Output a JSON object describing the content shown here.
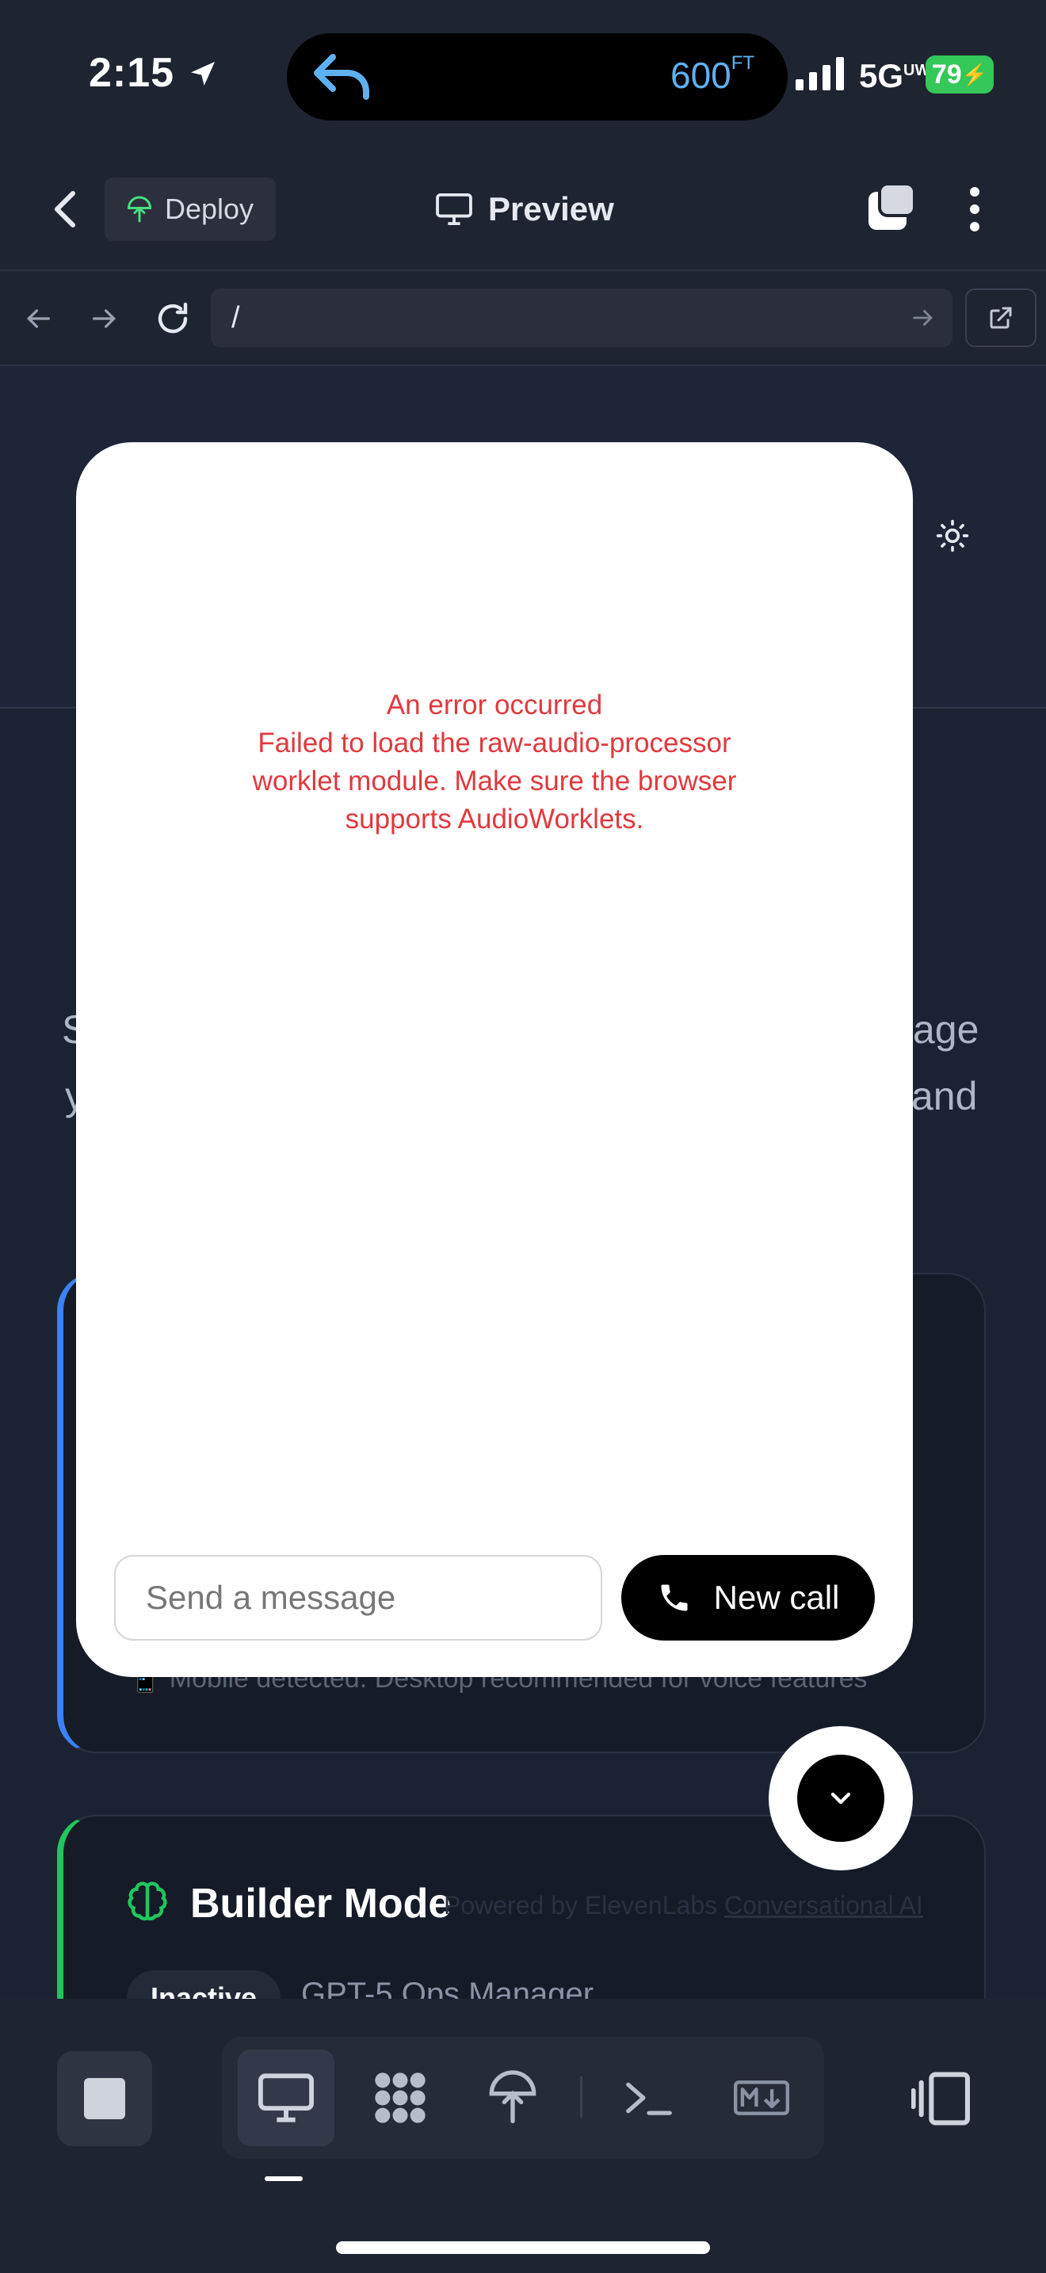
{
  "status_bar": {
    "time": "2:15",
    "altitude": "600",
    "altitude_unit": "FT",
    "network": "5G",
    "network_sup": "UW",
    "battery": "79"
  },
  "header": {
    "deploy_label": "Deploy",
    "preview_label": "Preview"
  },
  "browser": {
    "url": "/"
  },
  "background": {
    "partial_left_1": "S",
    "partial_left_2": "y",
    "partial_right_1": "age",
    "partial_right_2": "and",
    "mobile_note": "Mobile detected. Desktop recommended for voice features",
    "builder_title": "Builder Mode",
    "powered_by": "Powered by ElevenLabs",
    "powered_link": "Conversational AI",
    "status_badge": "Inactive",
    "agent_name": "GPT-5 Ops Manager"
  },
  "modal": {
    "error_title": "An error occurred",
    "error_message": "Failed to load the raw-audio-processor worklet module. Make sure the browser supports AudioWorklets.",
    "input_placeholder": "Send a message",
    "new_call_label": "New call"
  },
  "colors": {
    "error": "#e0393e",
    "accent_blue": "#3b82f6",
    "accent_green": "#22c55e"
  }
}
